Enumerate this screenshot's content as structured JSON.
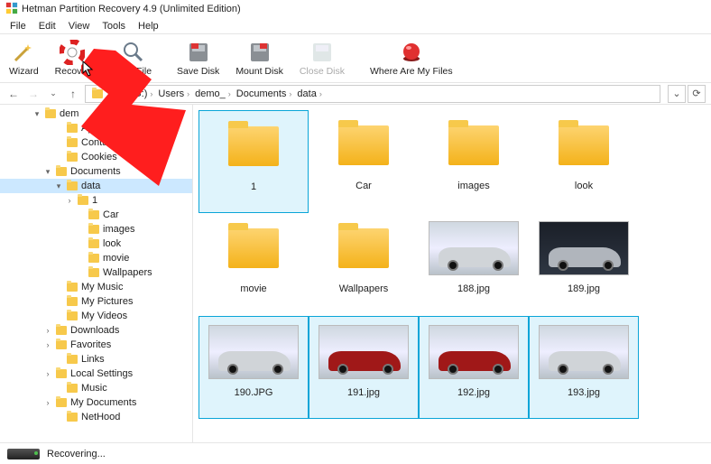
{
  "title": "Hetman Partition Recovery 4.9 (Unlimited Edition)",
  "menu": [
    "File",
    "Edit",
    "View",
    "Tools",
    "Help"
  ],
  "toolbar": {
    "wizard": "Wizard",
    "recover": "Recover",
    "find": "Find File",
    "save": "Save Disk",
    "mount": "Mount Disk",
    "close": "Close Disk",
    "where": "Where Are My Files"
  },
  "breadcrumbs": [
    "Disk (G:)",
    "Users",
    "demo_",
    "Documents",
    "data"
  ],
  "tree": [
    {
      "d": 3,
      "exp": "▾",
      "label": "dem",
      "icon": "folder"
    },
    {
      "d": 5,
      "exp": "",
      "label": "Applicati…",
      "icon": "folder"
    },
    {
      "d": 5,
      "exp": "",
      "label": "Contacts",
      "icon": "folder"
    },
    {
      "d": 5,
      "exp": "",
      "label": "Cookies",
      "icon": "folder"
    },
    {
      "d": 4,
      "exp": "▾",
      "label": "Documents",
      "icon": "folder"
    },
    {
      "d": 5,
      "exp": "▾",
      "label": "data",
      "icon": "folder",
      "sel": true
    },
    {
      "d": 6,
      "exp": "›",
      "label": "1",
      "icon": "folder"
    },
    {
      "d": 7,
      "exp": "",
      "label": "Car",
      "icon": "folder"
    },
    {
      "d": 7,
      "exp": "",
      "label": "images",
      "icon": "folder"
    },
    {
      "d": 7,
      "exp": "",
      "label": "look",
      "icon": "folder"
    },
    {
      "d": 7,
      "exp": "",
      "label": "movie",
      "icon": "folder"
    },
    {
      "d": 7,
      "exp": "",
      "label": "Wallpapers",
      "icon": "folder"
    },
    {
      "d": 5,
      "exp": "",
      "label": "My Music",
      "icon": "folder"
    },
    {
      "d": 5,
      "exp": "",
      "label": "My Pictures",
      "icon": "folder"
    },
    {
      "d": 5,
      "exp": "",
      "label": "My Videos",
      "icon": "folder"
    },
    {
      "d": 4,
      "exp": "›",
      "label": "Downloads",
      "icon": "folder"
    },
    {
      "d": 4,
      "exp": "›",
      "label": "Favorites",
      "icon": "folder"
    },
    {
      "d": 5,
      "exp": "",
      "label": "Links",
      "icon": "folder"
    },
    {
      "d": 4,
      "exp": "›",
      "label": "Local Settings",
      "icon": "folder"
    },
    {
      "d": 5,
      "exp": "",
      "label": "Music",
      "icon": "folder"
    },
    {
      "d": 4,
      "exp": "›",
      "label": "My Documents",
      "icon": "folder"
    },
    {
      "d": 5,
      "exp": "",
      "label": "NetHood",
      "icon": "folder"
    }
  ],
  "files": [
    {
      "name": "1",
      "kind": "folder",
      "sel": true
    },
    {
      "name": "Car",
      "kind": "folder"
    },
    {
      "name": "images",
      "kind": "folder"
    },
    {
      "name": "look",
      "kind": "folder"
    },
    {
      "name": "movie",
      "kind": "folder"
    },
    {
      "name": "Wallpapers",
      "kind": "folder"
    },
    {
      "name": "188.jpg",
      "kind": "car-light"
    },
    {
      "name": "189.jpg",
      "kind": "car-dark"
    },
    {
      "name": "190.JPG",
      "kind": "car-light",
      "sel": true
    },
    {
      "name": "191.jpg",
      "kind": "car-red",
      "sel": true
    },
    {
      "name": "192.jpg",
      "kind": "car-red",
      "sel": true
    },
    {
      "name": "193.jpg",
      "kind": "car-light",
      "sel": true
    }
  ],
  "status": "Recovering..."
}
